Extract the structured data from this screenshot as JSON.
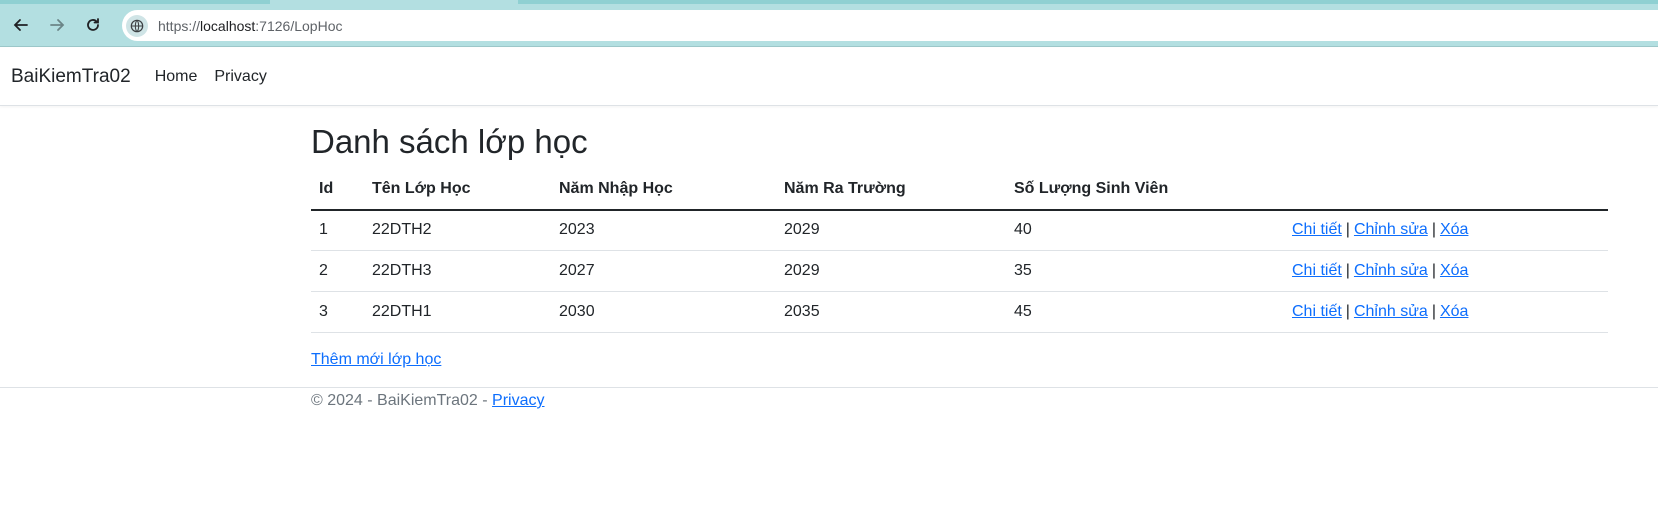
{
  "browser": {
    "url_scheme": "https://",
    "url_host": "localhost",
    "url_rest": ":7126/LopHoc"
  },
  "navbar": {
    "brand": "BaiKiemTra02",
    "links": [
      "Home",
      "Privacy"
    ]
  },
  "page": {
    "title": "Danh sách lớp học",
    "add_link": "Thêm mới lớp học"
  },
  "table": {
    "headers": [
      "Id",
      "Tên Lớp Học",
      "Năm Nhập Học",
      "Năm Ra Trường",
      "Số Lượng Sinh Viên",
      ""
    ],
    "rows": [
      {
        "id": "1",
        "name": "22DTH2",
        "start": "2023",
        "end": "2029",
        "count": "40"
      },
      {
        "id": "2",
        "name": "22DTH3",
        "start": "2027",
        "end": "2029",
        "count": "35"
      },
      {
        "id": "3",
        "name": "22DTH1",
        "start": "2030",
        "end": "2035",
        "count": "45"
      }
    ],
    "actions": {
      "details": "Chi tiết",
      "edit": "Chỉnh sửa",
      "delete": "Xóa",
      "separator": "|"
    }
  },
  "footer": {
    "text": "© 2024 - BaiKiemTra02 - ",
    "privacy": "Privacy"
  },
  "colors": {
    "link": "#0d6efd",
    "browser_chrome": "#b3dfe1"
  }
}
